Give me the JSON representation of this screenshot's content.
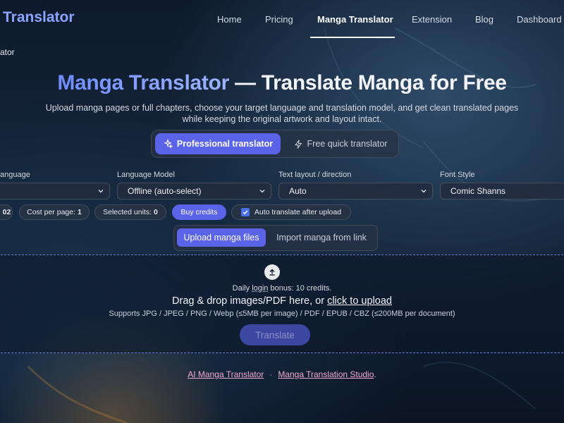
{
  "nav": {
    "brand": "Translator",
    "items": [
      {
        "label": "Home"
      },
      {
        "label": "Pricing"
      },
      {
        "label": "Manga Translator"
      },
      {
        "label": "Extension"
      },
      {
        "label": "Blog"
      },
      {
        "label": "Dashboard"
      }
    ],
    "active": "Manga Translator"
  },
  "breadcrumb": "ator",
  "hero": {
    "title_highlight": "Manga Translator",
    "title_rest": " — Translate Manga for Free",
    "subtitle": "Upload manga pages or full chapters, choose your target language and translation model, and get clean translated pages while keeping the original artwork and layout intact."
  },
  "mode": {
    "pro_label": "Professional translator",
    "pro_icon": "sparkles-icon",
    "free_label": "Free quick translator",
    "free_icon": "bolt-icon"
  },
  "settings": {
    "language_label": "anguage",
    "language_value": "",
    "model_label": "Language Model",
    "model_value": "Offline (auto-select)",
    "layout_label": "Text layout / direction",
    "layout_value": "Auto",
    "font_label": "Font Style",
    "font_value": "Comic Shanns"
  },
  "chips": {
    "credits_partial": "02",
    "cost_label": "Cost per page:",
    "cost_value": "1",
    "units_label": "Selected units:",
    "units_value": "0",
    "buy_label": "Buy credits",
    "auto_label": "Auto translate after upload",
    "auto_checked": true
  },
  "upload": {
    "files_label": "Upload manga files",
    "link_label": "Import manga from link"
  },
  "dropzone": {
    "bonus_pre": "Daily ",
    "bonus_login": "login",
    "bonus_post": " bonus: 10 credits.",
    "drag_text": "Drag & drop images/PDF here, or ",
    "click_text": "click to upload",
    "supports": "Supports JPG / JPEG / PNG / Webp (≤5MB per image) / PDF / EPUB / CBZ (≤200MB per document)",
    "translate_label": "Translate"
  },
  "footer": {
    "link1": "AI Manga Translator",
    "sep": "·",
    "link2": "Manga Translation Studio",
    "end": "."
  },
  "colors": {
    "accent": "#5b63e8",
    "title_gradient_start": "#6f8cff",
    "footer_link": "#f2a9d3",
    "dropzone_border": "#6c78d8"
  }
}
